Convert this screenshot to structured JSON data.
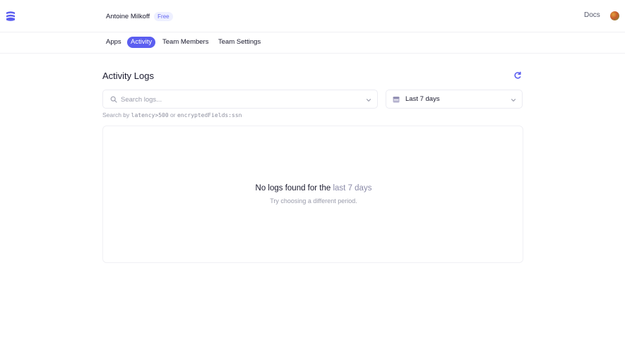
{
  "header": {
    "account_name": "Antoine Milkoff",
    "plan_badge": "Free",
    "docs_label": "Docs"
  },
  "nav": {
    "tabs": [
      {
        "label": "Apps",
        "active": false
      },
      {
        "label": "Activity",
        "active": true
      },
      {
        "label": "Team Members",
        "active": false
      },
      {
        "label": "Team Settings",
        "active": false
      }
    ]
  },
  "main": {
    "title": "Activity Logs",
    "search": {
      "placeholder": "Search logs...",
      "value": ""
    },
    "period": {
      "selected": "Last 7 days"
    },
    "hint": {
      "prefix": "Search by",
      "example1": "latency>500",
      "connector": "or",
      "example2": "encryptedFields:ssn"
    },
    "empty_state": {
      "title_prefix": "No logs found for the",
      "title_period": "last 7 days",
      "subtitle": "Try choosing a different period."
    }
  },
  "colors": {
    "accent": "#5b5ef0",
    "badge_bg": "#eef0ff",
    "muted_text": "#9a9cab"
  },
  "icons": [
    "logo-icon",
    "avatar",
    "refresh-icon",
    "search-icon",
    "chevron-down-icon",
    "calendar-icon"
  ]
}
